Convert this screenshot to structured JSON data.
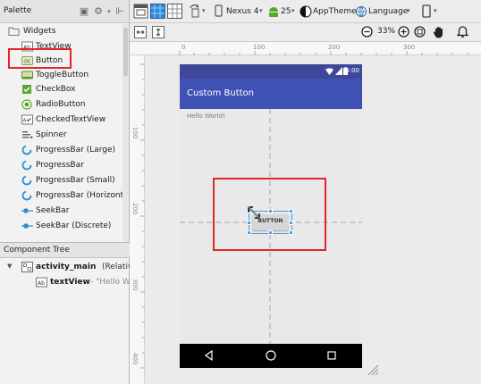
{
  "palette": {
    "title": "Palette",
    "group_label": "Widgets",
    "items": [
      {
        "label": "TextView",
        "icon": "textview-icon"
      },
      {
        "label": "Button",
        "icon": "button-icon"
      },
      {
        "label": "ToggleButton",
        "icon": "togglebutton-icon"
      },
      {
        "label": "CheckBox",
        "icon": "checkbox-icon"
      },
      {
        "label": "RadioButton",
        "icon": "radiobutton-icon"
      },
      {
        "label": "CheckedTextView",
        "icon": "checkedtextview-icon"
      },
      {
        "label": "Spinner",
        "icon": "spinner-icon"
      },
      {
        "label": "ProgressBar (Large)",
        "icon": "progressbar-icon"
      },
      {
        "label": "ProgressBar",
        "icon": "progressbar-icon"
      },
      {
        "label": "ProgressBar (Small)",
        "icon": "progressbar-icon"
      },
      {
        "label": "ProgressBar (Horizontal)",
        "icon": "progressbar-icon"
      },
      {
        "label": "SeekBar",
        "icon": "seekbar-icon"
      },
      {
        "label": "SeekBar (Discrete)",
        "icon": "seekbar-icon"
      }
    ]
  },
  "component_tree": {
    "title": "Component Tree",
    "root": {
      "name": "activity_main",
      "type": "(RelativeLa"
    },
    "child": {
      "name": "textView",
      "value": "- \"Hello W"
    }
  },
  "toolbar": {
    "device": "Nexus 4",
    "api": "25",
    "theme": "AppTheme",
    "language": "Language",
    "zoom": "33%"
  },
  "ruler": {
    "top_ticks": [
      "0",
      "100",
      "200",
      "300"
    ],
    "left_ticks": [
      "100",
      "200",
      "300",
      "400"
    ]
  },
  "phone": {
    "status_time": "6:00",
    "app_title": "Custom Button",
    "hello_text": "Hello World!",
    "button_label": "BUTTON"
  },
  "colors": {
    "primary": "#3f51b5",
    "primary_dark": "#3f479a",
    "highlight": "#e0262b",
    "selection": "#4a9fe0"
  }
}
